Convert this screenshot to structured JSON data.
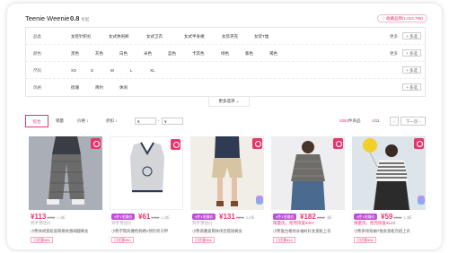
{
  "header": {
    "brand": "Teenie Weenie",
    "rating": "0.8",
    "rating_unit": "折起",
    "follow": "♡ 收藏品牌(1,024,708)"
  },
  "filters": [
    {
      "label": "品类",
      "options": [
        "女装针织衫",
        "女式休闲裤",
        "女式卫衣",
        "女式半身裙",
        "女装夹克",
        "女装T恤"
      ],
      "more": "更多",
      "multi": "+ 多选"
    },
    {
      "label": "颜色",
      "options": [
        "黑色",
        "灰色",
        "白色",
        "米色",
        "蓝色",
        "卡其色",
        "绿色",
        "紫色",
        "褐色"
      ],
      "more": "更多",
      "multi": "+ 多选"
    },
    {
      "label": "尺码",
      "options": [
        "XS",
        "S",
        "M",
        "L",
        "XL"
      ],
      "more": "",
      "multi": "+ 多选"
    },
    {
      "label": "风格",
      "options": [
        "街潮",
        "简约",
        "休闲"
      ],
      "more": "",
      "multi": "+ 多选"
    }
  ],
  "more_options": "更多选项 ⌄",
  "sort": {
    "items": [
      "综合",
      "销量",
      "价格 ↕",
      "折扣 ↕"
    ],
    "price_from": "¥",
    "price_to": "¥",
    "count_num": "2063",
    "count_unit": "件商品",
    "page_current": "1",
    "page_total": "/11",
    "prev": "‹",
    "next": "下一页 ›"
  },
  "products": [
    {
      "promo": "",
      "price": "¥113",
      "orig": "¥898",
      "disc": "1.3折",
      "sub": "到手预估价",
      "desc": "小熊休闲宽松直筒格纹感阔腿裤女",
      "tag": "已优惠¥85",
      "colors": {
        "bg": "#a9aeb7",
        "item": "#6b6b6b"
      }
    },
    {
      "promo": "4件1毛赚价",
      "price": "¥61",
      "orig": "¥498",
      "disc": "1.2折",
      "sub": "到手预估价",
      "desc": "小熊学院风撞色刺绣V领针织马甲",
      "tag": "已优惠¥60",
      "colors": {
        "bg": "#ffffff",
        "item": "#cfd1d5"
      }
    },
    {
      "promo": "4件1毛赚价",
      "price": "¥131",
      "orig": "¥898",
      "disc": "2.2折",
      "sub": "到手预估价",
      "desc": "小熊高腰直筒休闲百搭短裤女",
      "tag": "已优惠¥96",
      "colors": {
        "bg": "#f1ede7",
        "item": "#d6c4a2"
      }
    },
    {
      "promo": "4件1毛赚价",
      "price": "¥182",
      "orig": "¥898",
      "disc": "3折",
      "sub": "限量优。抢完恢复¥307",
      "desc": "小熊复古格纹长袖衬衫女宽松上衣",
      "tag": "已优惠¥16",
      "colors": {
        "bg": "#eeeef0",
        "item": "#6f6d6a"
      }
    },
    {
      "promo": "4件1毛赚价",
      "price": "¥59",
      "orig": "¥598",
      "disc": "1.3折",
      "sub": "限量优。抢完恢复¥123",
      "desc": "小熊条纹短袖T恤女宽松百搭上衣",
      "tag": "已优惠¥96",
      "colors": {
        "bg": "#dde4ea",
        "item": "#2b2b2b"
      }
    }
  ],
  "theme": {
    "accent": "#e8356d",
    "promo": "#c04fd8"
  }
}
